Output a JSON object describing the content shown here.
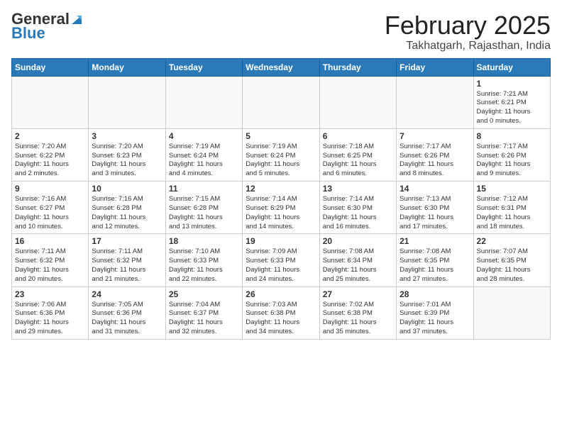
{
  "header": {
    "logo_general": "General",
    "logo_blue": "Blue",
    "month": "February 2025",
    "location": "Takhatgarh, Rajasthan, India"
  },
  "days_of_week": [
    "Sunday",
    "Monday",
    "Tuesday",
    "Wednesday",
    "Thursday",
    "Friday",
    "Saturday"
  ],
  "weeks": [
    [
      {
        "day": "",
        "info": ""
      },
      {
        "day": "",
        "info": ""
      },
      {
        "day": "",
        "info": ""
      },
      {
        "day": "",
        "info": ""
      },
      {
        "day": "",
        "info": ""
      },
      {
        "day": "",
        "info": ""
      },
      {
        "day": "1",
        "info": "Sunrise: 7:21 AM\nSunset: 6:21 PM\nDaylight: 11 hours\nand 0 minutes."
      }
    ],
    [
      {
        "day": "2",
        "info": "Sunrise: 7:20 AM\nSunset: 6:22 PM\nDaylight: 11 hours\nand 2 minutes."
      },
      {
        "day": "3",
        "info": "Sunrise: 7:20 AM\nSunset: 6:23 PM\nDaylight: 11 hours\nand 3 minutes."
      },
      {
        "day": "4",
        "info": "Sunrise: 7:19 AM\nSunset: 6:24 PM\nDaylight: 11 hours\nand 4 minutes."
      },
      {
        "day": "5",
        "info": "Sunrise: 7:19 AM\nSunset: 6:24 PM\nDaylight: 11 hours\nand 5 minutes."
      },
      {
        "day": "6",
        "info": "Sunrise: 7:18 AM\nSunset: 6:25 PM\nDaylight: 11 hours\nand 6 minutes."
      },
      {
        "day": "7",
        "info": "Sunrise: 7:17 AM\nSunset: 6:26 PM\nDaylight: 11 hours\nand 8 minutes."
      },
      {
        "day": "8",
        "info": "Sunrise: 7:17 AM\nSunset: 6:26 PM\nDaylight: 11 hours\nand 9 minutes."
      }
    ],
    [
      {
        "day": "9",
        "info": "Sunrise: 7:16 AM\nSunset: 6:27 PM\nDaylight: 11 hours\nand 10 minutes."
      },
      {
        "day": "10",
        "info": "Sunrise: 7:16 AM\nSunset: 6:28 PM\nDaylight: 11 hours\nand 12 minutes."
      },
      {
        "day": "11",
        "info": "Sunrise: 7:15 AM\nSunset: 6:28 PM\nDaylight: 11 hours\nand 13 minutes."
      },
      {
        "day": "12",
        "info": "Sunrise: 7:14 AM\nSunset: 6:29 PM\nDaylight: 11 hours\nand 14 minutes."
      },
      {
        "day": "13",
        "info": "Sunrise: 7:14 AM\nSunset: 6:30 PM\nDaylight: 11 hours\nand 16 minutes."
      },
      {
        "day": "14",
        "info": "Sunrise: 7:13 AM\nSunset: 6:30 PM\nDaylight: 11 hours\nand 17 minutes."
      },
      {
        "day": "15",
        "info": "Sunrise: 7:12 AM\nSunset: 6:31 PM\nDaylight: 11 hours\nand 18 minutes."
      }
    ],
    [
      {
        "day": "16",
        "info": "Sunrise: 7:11 AM\nSunset: 6:32 PM\nDaylight: 11 hours\nand 20 minutes."
      },
      {
        "day": "17",
        "info": "Sunrise: 7:11 AM\nSunset: 6:32 PM\nDaylight: 11 hours\nand 21 minutes."
      },
      {
        "day": "18",
        "info": "Sunrise: 7:10 AM\nSunset: 6:33 PM\nDaylight: 11 hours\nand 22 minutes."
      },
      {
        "day": "19",
        "info": "Sunrise: 7:09 AM\nSunset: 6:33 PM\nDaylight: 11 hours\nand 24 minutes."
      },
      {
        "day": "20",
        "info": "Sunrise: 7:08 AM\nSunset: 6:34 PM\nDaylight: 11 hours\nand 25 minutes."
      },
      {
        "day": "21",
        "info": "Sunrise: 7:08 AM\nSunset: 6:35 PM\nDaylight: 11 hours\nand 27 minutes."
      },
      {
        "day": "22",
        "info": "Sunrise: 7:07 AM\nSunset: 6:35 PM\nDaylight: 11 hours\nand 28 minutes."
      }
    ],
    [
      {
        "day": "23",
        "info": "Sunrise: 7:06 AM\nSunset: 6:36 PM\nDaylight: 11 hours\nand 29 minutes."
      },
      {
        "day": "24",
        "info": "Sunrise: 7:05 AM\nSunset: 6:36 PM\nDaylight: 11 hours\nand 31 minutes."
      },
      {
        "day": "25",
        "info": "Sunrise: 7:04 AM\nSunset: 6:37 PM\nDaylight: 11 hours\nand 32 minutes."
      },
      {
        "day": "26",
        "info": "Sunrise: 7:03 AM\nSunset: 6:38 PM\nDaylight: 11 hours\nand 34 minutes."
      },
      {
        "day": "27",
        "info": "Sunrise: 7:02 AM\nSunset: 6:38 PM\nDaylight: 11 hours\nand 35 minutes."
      },
      {
        "day": "28",
        "info": "Sunrise: 7:01 AM\nSunset: 6:39 PM\nDaylight: 11 hours\nand 37 minutes."
      },
      {
        "day": "",
        "info": ""
      }
    ]
  ]
}
